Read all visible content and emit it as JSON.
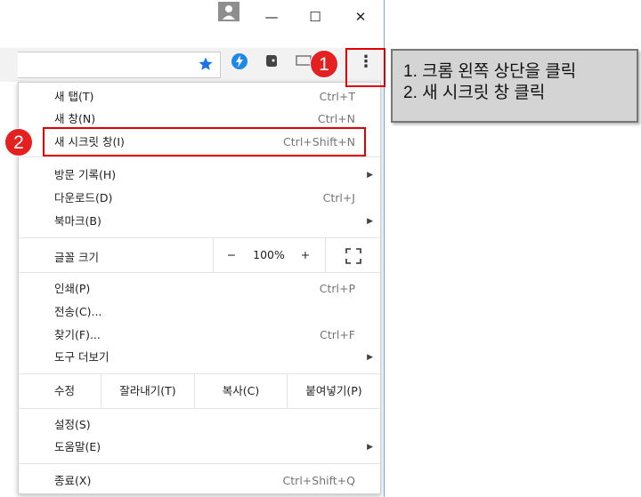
{
  "window": {
    "minimize_glyph": "—",
    "maximize_glyph": "☐",
    "close_glyph": "✕"
  },
  "toolbar": {
    "star_icon": "star-icon",
    "menu_glyph": "⋮"
  },
  "menu": {
    "items_top": [
      {
        "label": "새 탭(T)",
        "shortcut": "Ctrl+T"
      },
      {
        "label": "새 창(N)",
        "shortcut": "Ctrl+N"
      },
      {
        "label": "새 시크릿 창(I)",
        "shortcut": "Ctrl+Shift+N"
      }
    ],
    "history": {
      "label": "방문 기록(H)"
    },
    "downloads": {
      "label": "다운로드(D)",
      "shortcut": "Ctrl+J"
    },
    "bookmarks": {
      "label": "북마크(B)"
    },
    "zoom": {
      "label": "글꼴 크기",
      "minus": "−",
      "value": "100%",
      "plus": "+"
    },
    "print": {
      "label": "인쇄(P)",
      "shortcut": "Ctrl+P"
    },
    "cast": {
      "label": "전송(C)..."
    },
    "find": {
      "label": "찾기(F)...",
      "shortcut": "Ctrl+F"
    },
    "more_tools": {
      "label": "도구 더보기"
    },
    "edit": {
      "label": "수정",
      "cut": "잘라내기(T)",
      "copy": "복사(C)",
      "paste": "붙여넣기(P)"
    },
    "settings": {
      "label": "설정(S)"
    },
    "help": {
      "label": "도움말(E)"
    },
    "exit": {
      "label": "종료(X)",
      "shortcut": "Ctrl+Shift+Q"
    }
  },
  "annotations": {
    "badge1": "1",
    "badge2": "2",
    "step1": "1. 크롬 왼쪽 상단을 클릭",
    "step2": "2. 새 시크릿 창 클릭"
  },
  "colors": {
    "highlight": "#e00000",
    "star": "#1a73e8"
  }
}
